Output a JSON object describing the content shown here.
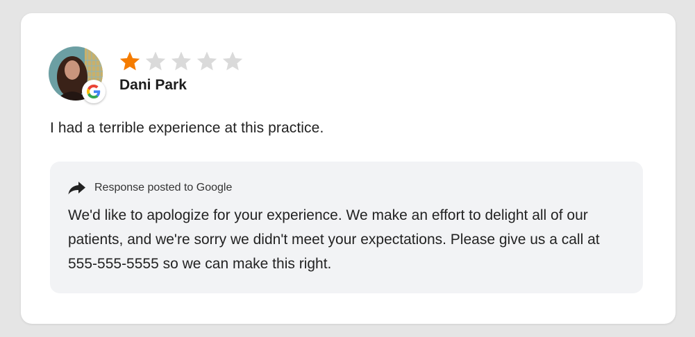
{
  "review": {
    "rating": 1,
    "max_rating": 5,
    "star_color_filled": "#f57c00",
    "star_color_empty": "#dadada",
    "reviewer_name": "Dani Park",
    "source_icon": "google-icon",
    "text": "I had a terrible experience at this practice."
  },
  "response": {
    "icon": "reply-arrow-icon",
    "label": "Response posted to Google",
    "text": "We'd like to apologize for your experience. We make an effort to delight all of our patients, and we're sorry we didn't meet your expectations. Please give us a call at 555-555-5555 so we can make this right."
  }
}
